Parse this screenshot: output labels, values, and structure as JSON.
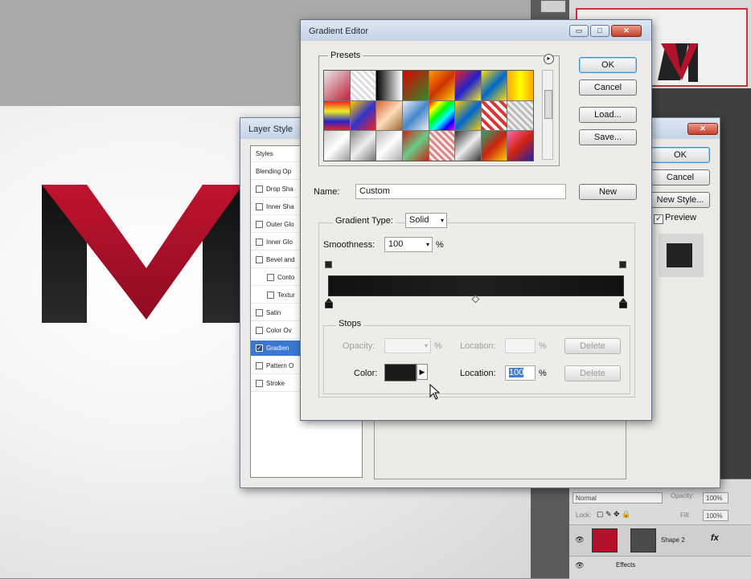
{
  "layer_style": {
    "title": "Layer Style",
    "list_header": "Styles",
    "blending_options": "Blending Op",
    "items": [
      {
        "label": "Drop Sha",
        "checked": false,
        "indent": false
      },
      {
        "label": "Inner Sha",
        "checked": false,
        "indent": false
      },
      {
        "label": "Outer Glo",
        "checked": false,
        "indent": false
      },
      {
        "label": "Inner Glo",
        "checked": false,
        "indent": false
      },
      {
        "label": "Bevel and",
        "checked": false,
        "indent": false
      },
      {
        "label": "Conto",
        "checked": false,
        "indent": true
      },
      {
        "label": "Textur",
        "checked": false,
        "indent": true
      },
      {
        "label": "Satin",
        "checked": false,
        "indent": false
      },
      {
        "label": "Color Ov",
        "checked": false,
        "indent": false
      },
      {
        "label": "Gradien",
        "checked": true,
        "indent": false
      },
      {
        "label": "Pattern O",
        "checked": false,
        "indent": false
      },
      {
        "label": "Stroke",
        "checked": false,
        "indent": false
      }
    ],
    "ok_label": "OK",
    "cancel_label": "Cancel",
    "new_style_label": "New Style...",
    "preview_label": "Preview",
    "close_glyph": "✕"
  },
  "gradient_editor": {
    "title": "Gradient Editor",
    "presets_label": "Presets",
    "gear_glyph": "▸",
    "ok_label": "OK",
    "cancel_label": "Cancel",
    "load_label": "Load...",
    "save_label": "Save...",
    "name_label": "Name:",
    "name_value": "Custom",
    "new_label": "New",
    "gradient_type_label": "Gradient Type:",
    "gradient_type_value": "Solid",
    "smoothness_label": "Smoothness:",
    "smoothness_value": "100",
    "percent": "%",
    "stops_label": "Stops",
    "opacity_label": "Opacity:",
    "location_label": "Location:",
    "delete_label": "Delete",
    "color_label": "Color:",
    "color_location_value": "100",
    "color_arrow_glyph": "▶",
    "dropdown_glyph": "▾",
    "minimize_glyph": "▭",
    "maximize_glyph": "□",
    "close_glyph": "✕",
    "colors": {
      "accent_red": "#b3122b",
      "gradient_dark": "#111111"
    },
    "presets": [
      "linear-gradient(135deg,#e8e8e8,#c0203a)",
      "repeating-linear-gradient(45deg,#ddd 0 3px,#fff 3px 6px)",
      "linear-gradient(90deg,#000,#fff)",
      "linear-gradient(135deg,#d00,#2a8d2a)",
      "linear-gradient(135deg,#f90,#c30 50%,#fc0)",
      "linear-gradient(135deg,#e22,#22c 50%,#ee2)",
      "linear-gradient(135deg,#fd0,#06c 50%,#fd0)",
      "linear-gradient(90deg,#fa0,#ff0 50%,#fa0)",
      "linear-gradient(180deg,#e22 0%,#ee2 35%,#22c 70%,#e22)",
      "linear-gradient(135deg,#fc0,#33c 50%,#e22)",
      "linear-gradient(135deg,#c63,#fdb 50%,#963)",
      "linear-gradient(135deg,#eee,#48c 50%,#eee)",
      "linear-gradient(135deg,#f00,#ff0,#0f0,#0ff,#00f,#f0f)",
      "linear-gradient(135deg,#ffcc00,#0066cc 50%,#ffcc00)",
      "repeating-linear-gradient(45deg,#d33 0 4px,#fff 4px 8px)",
      "repeating-linear-gradient(45deg,#eee 0 3px,#bbb 3px 6px)",
      "linear-gradient(135deg,#ccc,#fff 50%,#999)",
      "linear-gradient(135deg,#888,#eee 50%,#777)",
      "linear-gradient(135deg,#bbb,#fff 50%,#aaa)",
      "linear-gradient(135deg,#c21,#6c8 50%,#c21)",
      "repeating-linear-gradient(45deg,#d88 0 3px,#fee 3px 6px)",
      "linear-gradient(135deg,#333,#eee 50%,#333)",
      "linear-gradient(135deg,#2a6,#c21 50%,#fc0)",
      "linear-gradient(135deg,#f6a,#c21 50%,#22a)"
    ]
  },
  "photoshop": {
    "blend_mode": "Normal",
    "opacity_label": "Opacity:",
    "opacity_value": "100%",
    "lock_label": "Lock:",
    "fill_label": "Fill:",
    "fill_value": "100%",
    "layer_name": "Shape 2",
    "fx_label": "fx",
    "effects_label": "Effects",
    "eye_glyph": "👁"
  }
}
